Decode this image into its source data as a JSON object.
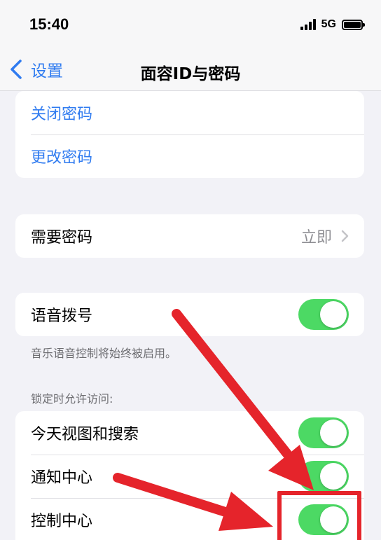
{
  "status_bar": {
    "time": "15:40",
    "network": "5G"
  },
  "nav": {
    "back_label": "设置",
    "title": "面容ID与密码"
  },
  "group1": {
    "items": [
      {
        "label": "关闭密码"
      },
      {
        "label": "更改密码"
      }
    ]
  },
  "require": {
    "label": "需要密码",
    "value": "立即"
  },
  "voice": {
    "label": "语音拨号",
    "on": true,
    "footer": "音乐语音控制将始终被启用。"
  },
  "lock": {
    "header": "锁定时允许访问:",
    "items": [
      {
        "label": "今天视图和搜索",
        "on": true
      },
      {
        "label": "通知中心",
        "on": true
      },
      {
        "label": "控制中心",
        "on": true
      }
    ]
  },
  "colors": {
    "accent": "#2f7bf0",
    "toggle_on": "#4cd964",
    "annotation_red": "#e5242b",
    "background": "#f2f2f7"
  }
}
